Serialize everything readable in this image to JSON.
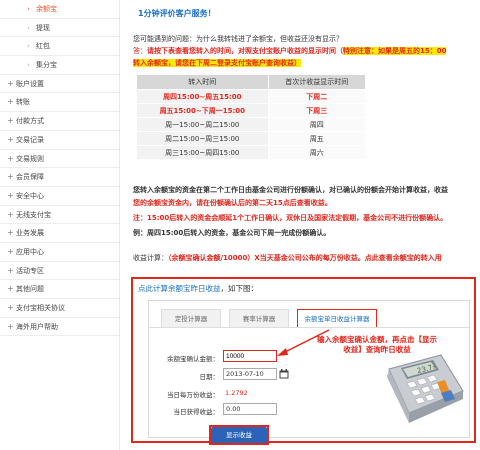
{
  "sidebar": {
    "items": [
      {
        "label": "余额宝",
        "level": "sub",
        "active": true
      },
      {
        "label": "提现",
        "level": "sub"
      },
      {
        "label": "红包",
        "level": "sub"
      },
      {
        "label": "集分宝",
        "level": "sub"
      },
      {
        "label": "账户设置",
        "level": "top"
      },
      {
        "label": "转账",
        "level": "top"
      },
      {
        "label": "付款方式",
        "level": "top"
      },
      {
        "label": "交易记录",
        "level": "top"
      },
      {
        "label": "交易规则",
        "level": "top"
      },
      {
        "label": "会员保障",
        "level": "top"
      },
      {
        "label": "安全中心",
        "level": "top"
      },
      {
        "label": "无线支付宝",
        "level": "top"
      },
      {
        "label": "业务发展",
        "level": "top"
      },
      {
        "label": "应用中心",
        "level": "top"
      },
      {
        "label": "活动专区",
        "level": "top"
      },
      {
        "label": "其他问题",
        "level": "top"
      },
      {
        "label": "支付宝相关协议",
        "level": "top"
      },
      {
        "label": "海外用户帮助",
        "level": "top"
      }
    ]
  },
  "main": {
    "title": "1分钟评价客户服务！",
    "question": "您可能遇到的问题：为什么我转钱进了余额宝，但收益还没有显示？",
    "answer_prefix": "答：",
    "answer_red": "请按下表查看您转入的时间，对照支付宝账户收益的显示时间（",
    "answer_hl": "特别注意：如果是周五的15：00",
    "answer_line2": "转入余额宝，请您在下周二登录支付宝账户查询收益）",
    "table": {
      "headers": [
        "转入时间",
        "首次计收益显示时间"
      ],
      "rows": [
        {
          "in": "周四15:00~周五15:00",
          "show": "下周二",
          "hot": true
        },
        {
          "in": "周五15:00~下周一15:00",
          "show": "下周三",
          "hot": true
        },
        {
          "in": "周一15:00~周二15:00",
          "show": "周四"
        },
        {
          "in": "周二15:00~周三15:00",
          "show": "周五"
        },
        {
          "in": "周三15:00~周四15:00",
          "show": "周六"
        }
      ]
    },
    "para1": "您转入余额宝的资金在第二个工作日由基金公司进行份额确认，对已确认的份额会开始计算收益，收益",
    "para2_red": "您的余额宝资金内，请在份额确认后的第二天15点后查看收益。",
    "para3": "注：15:00后转入的资金会顺延1个工作日确认，双休日及国家法定假期，基金公司不进行份额确认。",
    "para4": "例：周四15:00后转入的资金，基金公司下周一完成份额确认。",
    "formula_prefix": "收益计算：",
    "formula_red": "（余额宝确认金额/10000）X当天基金公司公布的每万份收益。点此查看余额宝的转入用",
    "calc": {
      "head_link": "点此计算余额宝昨日收益",
      "head_suffix": "，如下图：",
      "tabs": [
        "定投计算器",
        "赛率计算器",
        "余额宝单日收益计算器"
      ],
      "amount_label": "余额宝确认金额：",
      "amount_value": "10000",
      "date_label": "日期：",
      "date_value": "2013-07-10",
      "per10k_label": "当日每万份收益：",
      "per10k_value": "1.2792",
      "earn_label": "当日获得收益：",
      "earn_value": "0.00",
      "button": "显示收益",
      "annotation": "输入余额宝确认金额，再点击【显示收益】查询昨日收益",
      "calculator_screen": "23.7₇"
    }
  },
  "colors": {
    "accent_red": "#e0261d",
    "link_blue": "#1a6fc4",
    "button_blue": "#2a63b8",
    "highlight": "#ffe800"
  }
}
